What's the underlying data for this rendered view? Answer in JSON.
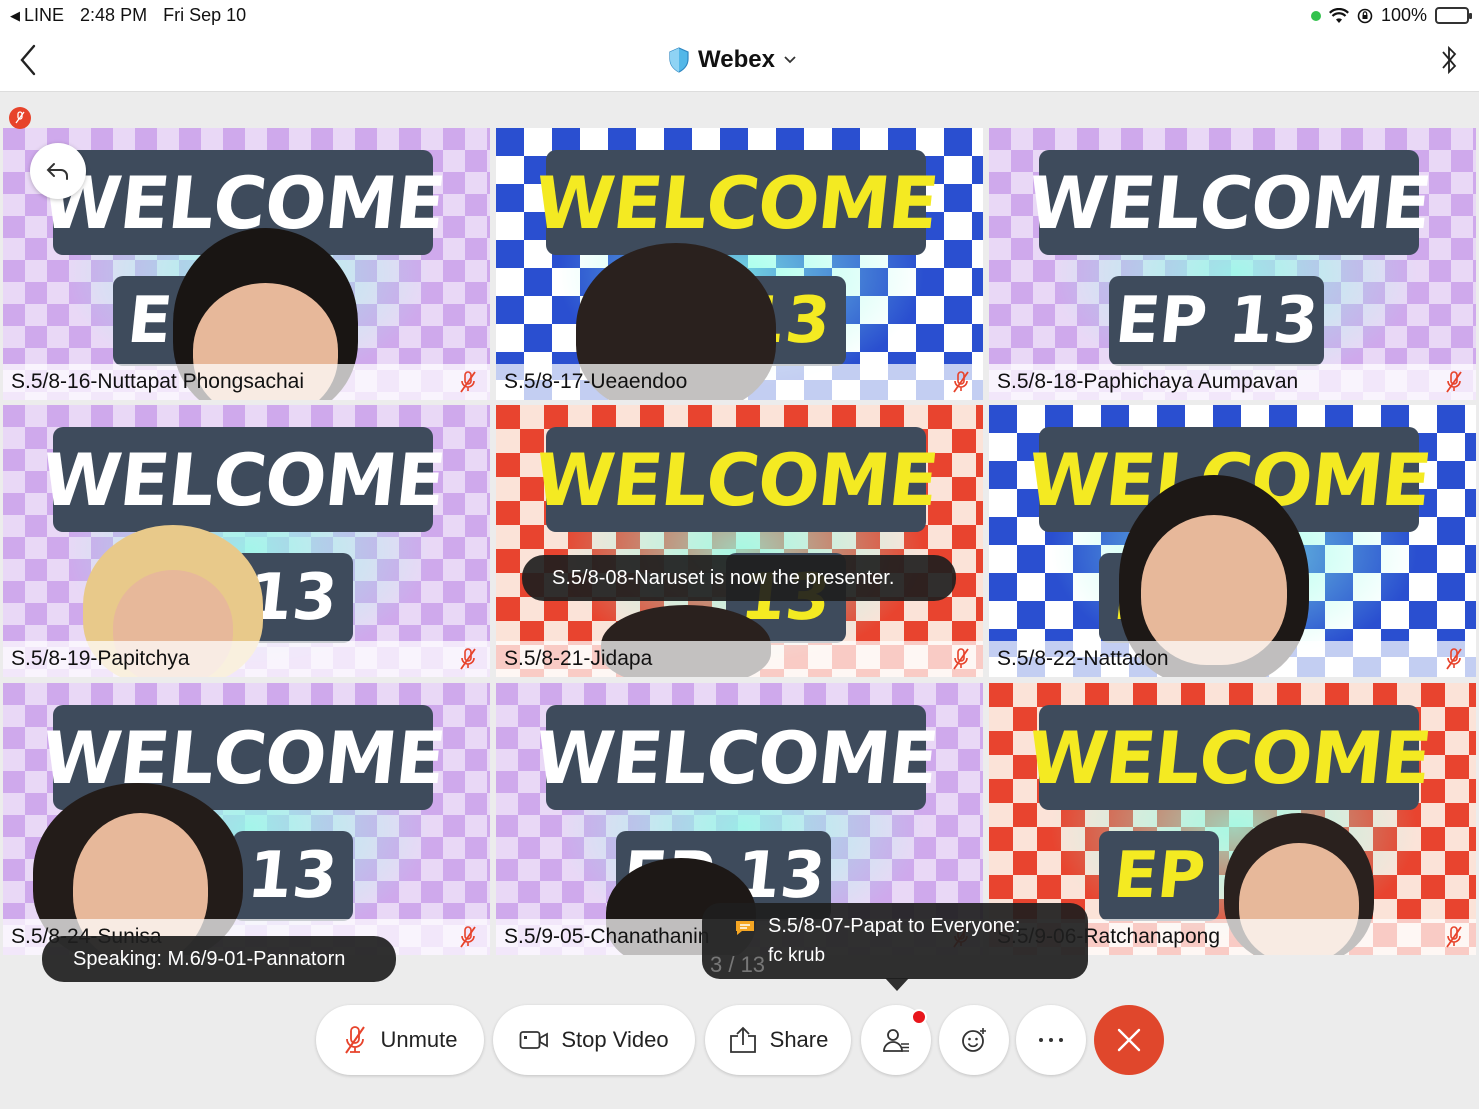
{
  "status_bar": {
    "back_app": "LINE",
    "time": "2:48 PM",
    "date": "Fri Sep 10",
    "battery": "100%",
    "colors": {
      "battery": "#33c24d",
      "dot": "#33c24d"
    }
  },
  "nav": {
    "title": "Webex"
  },
  "participants": [
    {
      "name": "S.5/8-16-Nuttapat Phongsachai",
      "theme": "pink",
      "text_color": "white",
      "sub": "EP"
    },
    {
      "name": "S.5/8-17-Ueaendoo",
      "theme": "blue",
      "text_color": "yellow",
      "sub": "13"
    },
    {
      "name": "S.5/8-18-Paphichaya Aumpavan",
      "theme": "pink",
      "text_color": "white",
      "sub": "EP 13"
    },
    {
      "name": "S.5/8-19-Papitchya",
      "theme": "pink",
      "text_color": "white",
      "sub": "13"
    },
    {
      "name": "S.5/8-21-Jidapa",
      "theme": "red",
      "text_color": "yellow",
      "sub": "13"
    },
    {
      "name": "S.5/8-22-Nattadon",
      "theme": "blue",
      "text_color": "yellow",
      "sub": "EP"
    },
    {
      "name": "S.5/8-24-Sunisa",
      "theme": "pink",
      "text_color": "white",
      "sub": "13"
    },
    {
      "name": "S.5/9-05-Chanathanin",
      "theme": "pink",
      "text_color": "white",
      "sub": "EP 13"
    },
    {
      "name": "S.5/9-06-Ratchanapong",
      "theme": "red",
      "text_color": "yellow",
      "sub": "EP"
    }
  ],
  "background_text": "WELCOME",
  "toasts": {
    "presenter": "S.5/8-08-Naruset is now the presenter.",
    "speaking": "Speaking: M.6/9-01-Pannatorn"
  },
  "chat": {
    "header": "S.5/8-07-Papat to Everyone:",
    "message": "fc krub"
  },
  "page_indicator": "3 / 13",
  "controls": {
    "unmute": "Unmute",
    "stop_video": "Stop Video",
    "share": "Share"
  },
  "colors": {
    "end_call": "#e0472c",
    "mute_red": "#e7432b",
    "notification": "#e8151b"
  }
}
